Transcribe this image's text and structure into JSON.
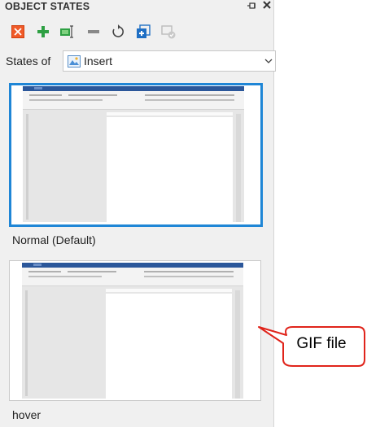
{
  "panel": {
    "title": "OBJECT STATES",
    "pin_icon": "pin-icon",
    "close_icon": "close-icon"
  },
  "toolbar": {
    "buttons": [
      {
        "name": "delete-state-button",
        "icon": "red-x-icon"
      },
      {
        "name": "add-state-button",
        "icon": "green-plus-icon"
      },
      {
        "name": "edit-state-button",
        "icon": "edit-state-icon"
      },
      {
        "name": "remove-state-button",
        "icon": "minus-icon"
      },
      {
        "name": "reset-state-button",
        "icon": "reset-icon"
      },
      {
        "name": "duplicate-state-button",
        "icon": "duplicate-icon"
      },
      {
        "name": "state-settings-button",
        "icon": "state-check-icon"
      }
    ]
  },
  "states_of": {
    "label": "States of",
    "selected": "Insert",
    "icon": "image-icon"
  },
  "states": [
    {
      "label": "Normal (Default)",
      "selected": true
    },
    {
      "label": "hover",
      "selected": false
    }
  ],
  "callout": {
    "text": "GIF file",
    "color": "#e0241b"
  },
  "colors": {
    "accent": "#1f86d6",
    "panel_bg": "#f0f0f0"
  }
}
